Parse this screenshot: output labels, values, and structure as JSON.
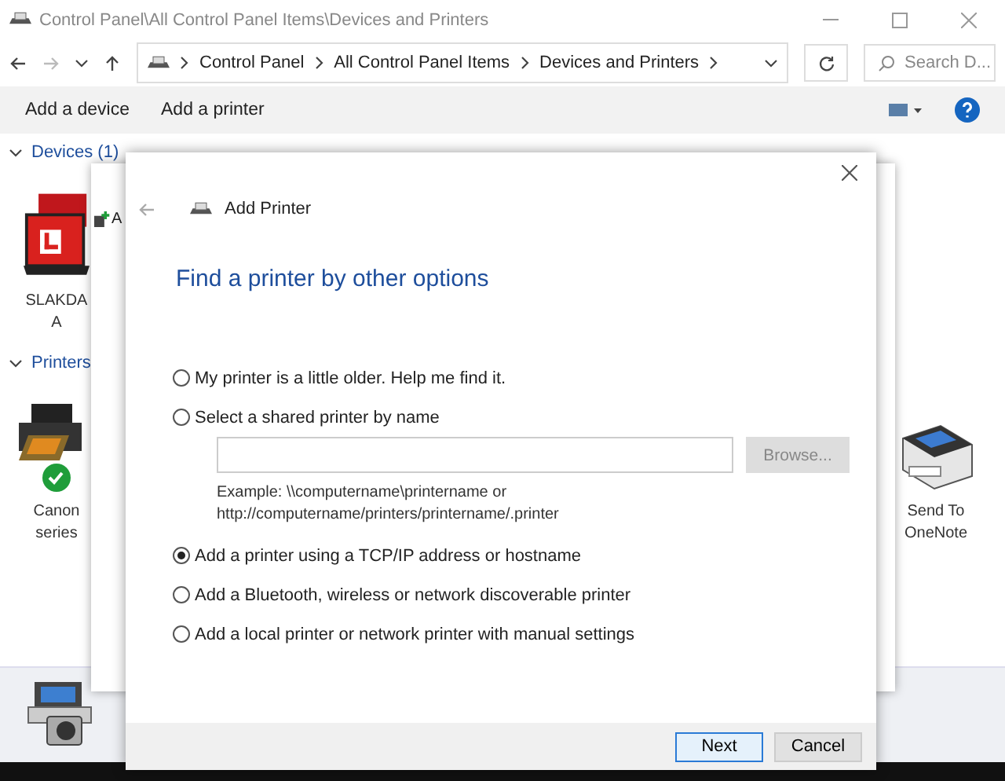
{
  "window": {
    "title": "Control Panel\\All Control Panel Items\\Devices and Printers"
  },
  "address_bar": {
    "crumbs": [
      "Control Panel",
      "All Control Panel Items",
      "Devices and Printers"
    ]
  },
  "search": {
    "placeholder": "Search D..."
  },
  "commands": [
    "Add a device",
    "Add a printer"
  ],
  "groups": [
    {
      "title": "Devices (1)",
      "expanded": true,
      "items": [
        {
          "kind": "laptop",
          "lines": [
            "SLAKDA",
            "A"
          ],
          "default": false
        }
      ]
    },
    {
      "title": "Printers",
      "expanded": true,
      "items": [
        {
          "kind": "printer",
          "lines": [
            "Canon",
            "series"
          ],
          "default": true
        },
        {
          "kind": "onenote",
          "lines": [
            "Send To",
            "OneNote"
          ],
          "default": false
        }
      ]
    }
  ],
  "back_dialog": {
    "title": "A"
  },
  "dialog": {
    "title": "Add Printer",
    "heading": "Find a printer by other options",
    "options": [
      {
        "label": "My printer is a little older. Help me find it.",
        "selected": false
      },
      {
        "label": "Select a shared printer by name",
        "selected": false,
        "path_field": {
          "browse": "Browse...",
          "browse_disabled": true,
          "example": [
            "Example: \\\\computername\\printername or",
            "http://computername/printers/printername/.printer"
          ]
        }
      },
      {
        "label": "Add a printer using a TCP/IP address or hostname",
        "selected": true
      },
      {
        "label": "Add a Bluetooth, wireless or network discoverable printer",
        "selected": false
      },
      {
        "label": "Add a local printer or network printer with manual settings",
        "selected": false
      }
    ],
    "buttons": [
      {
        "label": "Next",
        "default": true
      },
      {
        "label": "Cancel",
        "default": false
      }
    ]
  }
}
